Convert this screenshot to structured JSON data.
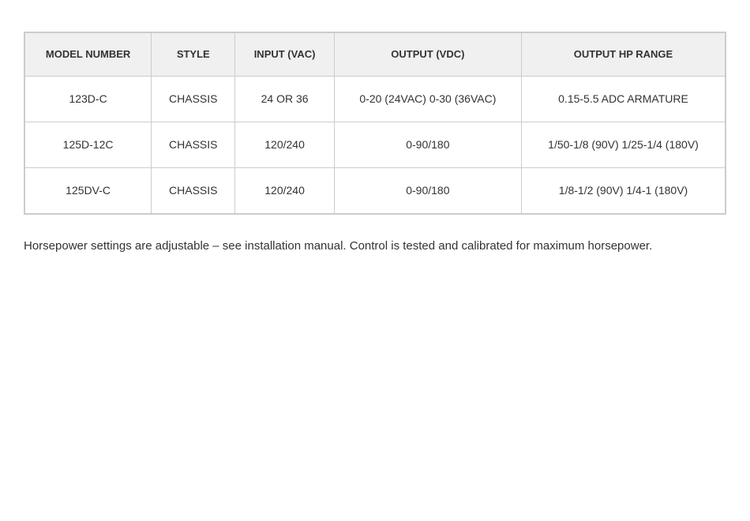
{
  "table": {
    "headers": [
      "MODEL NUMBER",
      "STYLE",
      "INPUT (VAC)",
      "OUTPUT (VDC)",
      "OUTPUT HP RANGE"
    ],
    "rows": [
      {
        "model": "123D-C",
        "style": "CHASSIS",
        "input": "24 OR 36",
        "output_vdc": "0-20 (24VAC) 0-30 (36VAC)",
        "output_hp": "0.15-5.5 ADC ARMATURE"
      },
      {
        "model": "125D-12C",
        "style": "CHASSIS",
        "input": "120/240",
        "output_vdc": "0-90/180",
        "output_hp": "1/50-1/8 (90V) 1/25-1/4 (180V)"
      },
      {
        "model": "125DV-C",
        "style": "CHASSIS",
        "input": "120/240",
        "output_vdc": "0-90/180",
        "output_hp": "1/8-1/2 (90V) 1/4-1 (180V)"
      }
    ]
  },
  "footer": {
    "note": "Horsepower settings are adjustable – see installation manual. Control is tested and calibrated for maximum horsepower."
  }
}
